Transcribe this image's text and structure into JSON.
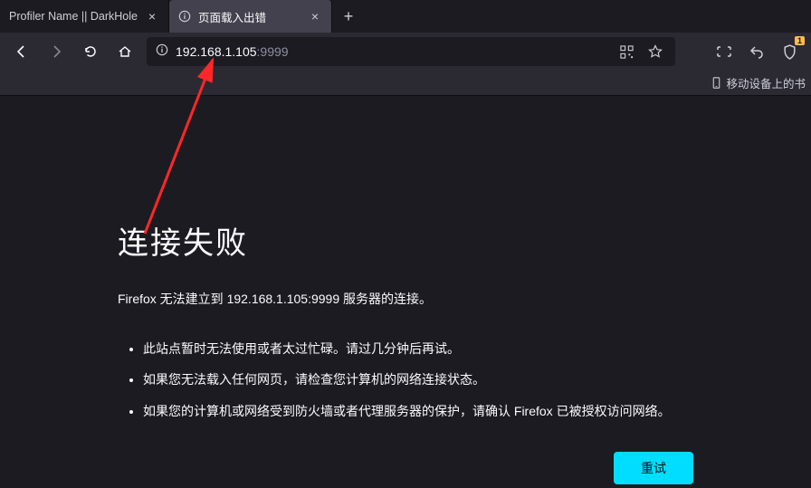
{
  "tabs": [
    {
      "title": "Profiler Name || DarkHole",
      "active": false
    },
    {
      "title": "页面载入出错",
      "active": true
    }
  ],
  "url": {
    "host": "192.168.1.105",
    "port": ":9999",
    "full": "192.168.1.105:9999"
  },
  "bookmarkbar": {
    "item": "移动设备上的书"
  },
  "error": {
    "title": "连接失败",
    "lead": "Firefox 无法建立到 192.168.1.105:9999 服务器的连接。",
    "items": [
      "此站点暂时无法使用或者太过忙碌。请过几分钟后再试。",
      "如果您无法载入任何网页，请检查您计算机的网络连接状态。",
      "如果您的计算机或网络受到防火墙或者代理服务器的保护，请确认 Firefox 已被授权访问网络。"
    ],
    "retry": "重试"
  },
  "badge": "1"
}
